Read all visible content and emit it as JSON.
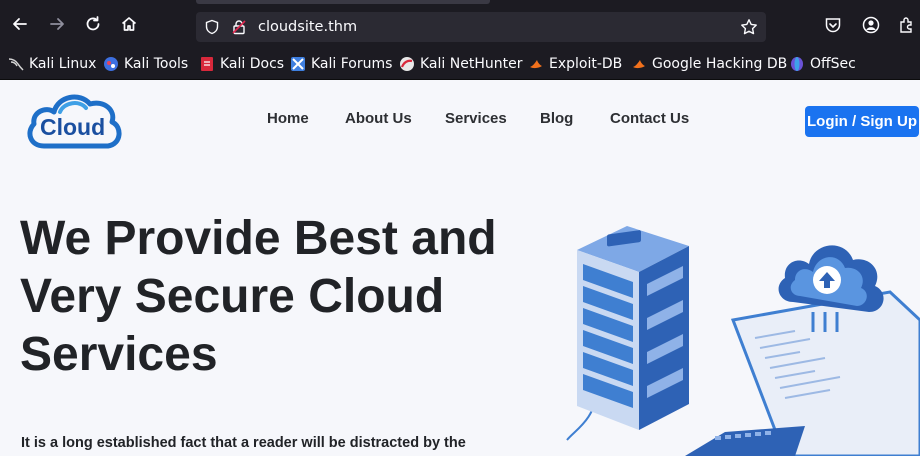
{
  "browser": {
    "url": "cloudsite.thm",
    "bookmarks": [
      {
        "label": "Kali Linux",
        "icon": "kali-dragon-icon"
      },
      {
        "label": "Kali Tools",
        "icon": "kali-tools-icon"
      },
      {
        "label": "Kali Docs",
        "icon": "kali-docs-icon"
      },
      {
        "label": "Kali Forums",
        "icon": "kali-forums-icon"
      },
      {
        "label": "Kali NetHunter",
        "icon": "kali-nethunter-icon"
      },
      {
        "label": "Exploit-DB",
        "icon": "exploit-db-icon"
      },
      {
        "label": "Google Hacking DB",
        "icon": "ghdb-icon"
      },
      {
        "label": "OffSec",
        "icon": "offsec-icon"
      }
    ]
  },
  "site": {
    "logo_text": "Cloud",
    "nav": [
      "Home",
      "About Us",
      "Services",
      "Blog",
      "Contact Us"
    ],
    "login_label": "Login / Sign Up",
    "hero_title_lines": [
      "We Provide Best and",
      "Very Secure Cloud",
      "Services"
    ],
    "hero_text": "It is a long established fact that a reader will be distracted by the"
  },
  "colors": {
    "accent": "#1a73f0",
    "logo_blue": "#1e6fc8",
    "server_blue": "#3f7fd1",
    "page_bg": "#f6f7fb"
  }
}
